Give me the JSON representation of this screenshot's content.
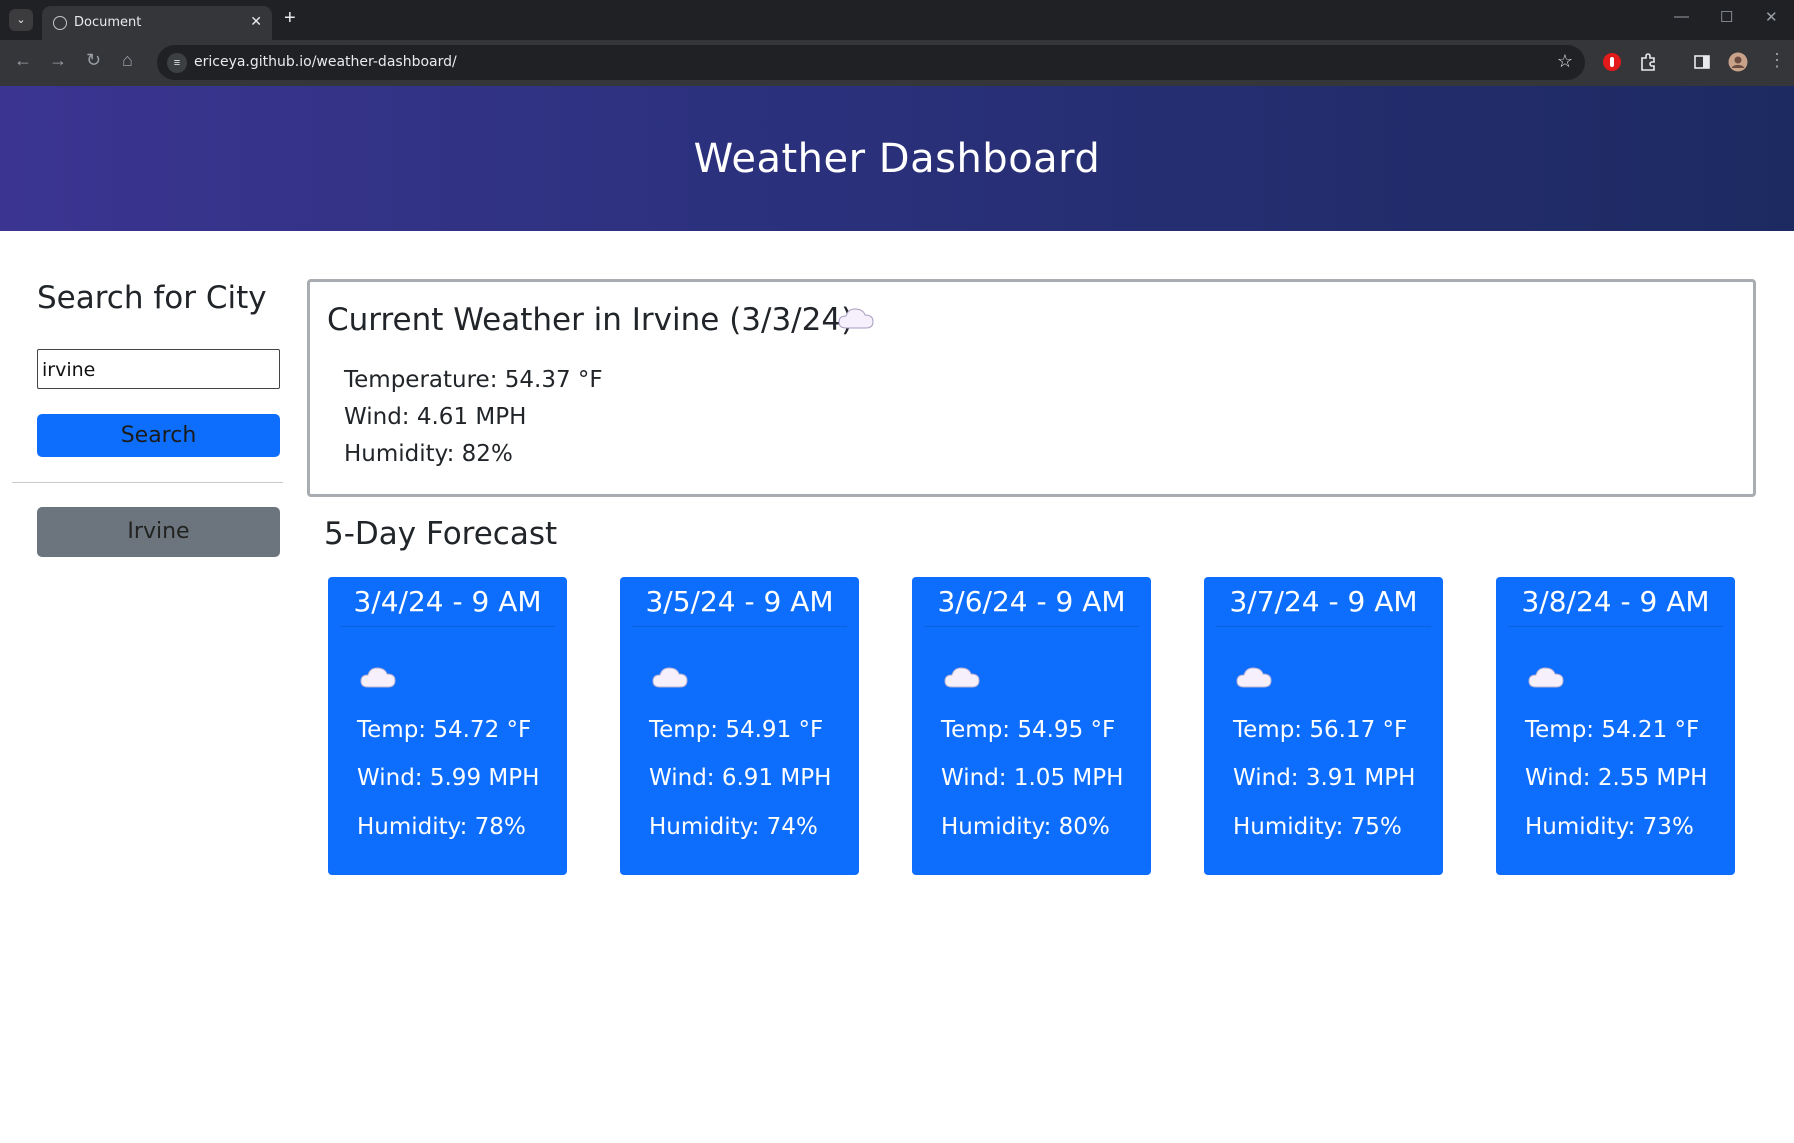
{
  "browser": {
    "tab_title": "Document",
    "url": "ericeya.github.io/weather-dashboard/"
  },
  "header": {
    "title": "Weather Dashboard"
  },
  "sidebar": {
    "title": "Search for City",
    "search_value": "irvine",
    "search_button": "Search",
    "history": [
      "Irvine"
    ]
  },
  "current": {
    "title": "Current Weather in Irvine (3/3/24)",
    "icon": "cloud-icon",
    "temperature": "Temperature: 54.37 °F",
    "wind": "Wind: 4.61 MPH",
    "humidity": "Humidity: 82%"
  },
  "forecast": {
    "title": "5-Day Forecast",
    "days": [
      {
        "date": "3/4/24 - 9 AM",
        "icon": "cloud-icon",
        "temp": "Temp: 54.72 °F",
        "wind": "Wind: 5.99 MPH",
        "humidity": "Humidity: 78%"
      },
      {
        "date": "3/5/24 - 9 AM",
        "icon": "cloud-icon",
        "temp": "Temp: 54.91 °F",
        "wind": "Wind: 6.91 MPH",
        "humidity": "Humidity: 74%"
      },
      {
        "date": "3/6/24 - 9 AM",
        "icon": "cloud-icon",
        "temp": "Temp: 54.95 °F",
        "wind": "Wind: 1.05 MPH",
        "humidity": "Humidity: 80%"
      },
      {
        "date": "3/7/24 - 9 AM",
        "icon": "cloud-icon",
        "temp": "Temp: 56.17 °F",
        "wind": "Wind: 3.91 MPH",
        "humidity": "Humidity: 75%"
      },
      {
        "date": "3/8/24 - 9 AM",
        "icon": "cloud-icon",
        "temp": "Temp: 54.21 °F",
        "wind": "Wind: 2.55 MPH",
        "humidity": "Humidity: 73%"
      }
    ]
  },
  "colors": {
    "header_gradient_start": "#3b3591",
    "header_gradient_end": "#1d2a61",
    "primary": "#0d6efd",
    "secondary": "#6c757d"
  }
}
